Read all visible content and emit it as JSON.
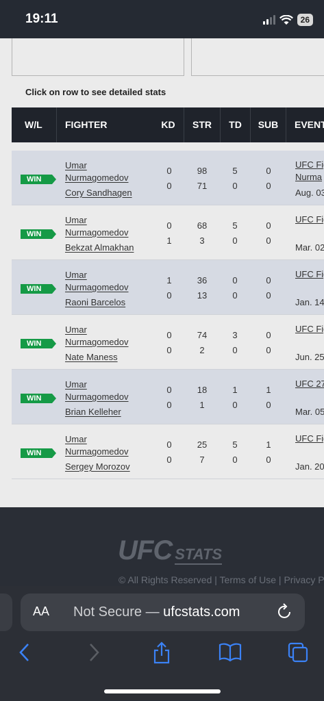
{
  "status": {
    "time": "19:11",
    "battery": "26"
  },
  "page": {
    "hint": "Click on row to see detailed stats"
  },
  "table": {
    "headers": [
      "W/L",
      "FIGHTER",
      "KD",
      "STR",
      "TD",
      "SUB",
      "EVENT"
    ],
    "rows": [
      {
        "result": "WIN",
        "f1a": "Umar",
        "f1b": "Nurmagomedov",
        "f2": "Cory Sandhagen",
        "kd": [
          "0",
          "0"
        ],
        "str": [
          "98",
          "71"
        ],
        "td": [
          "5",
          "0"
        ],
        "sub": [
          "0",
          "0"
        ],
        "event1": "UFC Fig",
        "event2": "Nurma",
        "date": "Aug. 03"
      },
      {
        "result": "WIN",
        "f1a": "Umar",
        "f1b": "Nurmagomedov",
        "f2": "Bekzat Almakhan",
        "kd": [
          "0",
          "1"
        ],
        "str": [
          "68",
          "3"
        ],
        "td": [
          "5",
          "0"
        ],
        "sub": [
          "0",
          "0"
        ],
        "event1": "UFC Fig",
        "event2": "",
        "date": "Mar. 02"
      },
      {
        "result": "WIN",
        "f1a": "Umar",
        "f1b": "Nurmagomedov",
        "f2": "Raoni Barcelos",
        "kd": [
          "1",
          "0"
        ],
        "str": [
          "36",
          "13"
        ],
        "td": [
          "0",
          "0"
        ],
        "sub": [
          "0",
          "0"
        ],
        "event1": "UFC Fig",
        "event2": "",
        "date": "Jan. 14"
      },
      {
        "result": "WIN",
        "f1a": "Umar",
        "f1b": "Nurmagomedov",
        "f2": "Nate Maness",
        "kd": [
          "0",
          "0"
        ],
        "str": [
          "74",
          "2"
        ],
        "td": [
          "3",
          "0"
        ],
        "sub": [
          "0",
          "0"
        ],
        "event1": "UFC Fig",
        "event2": "",
        "date": "Jun. 25"
      },
      {
        "result": "WIN",
        "f1a": "Umar",
        "f1b": "Nurmagomedov",
        "f2": "Brian Kelleher",
        "kd": [
          "0",
          "0"
        ],
        "str": [
          "18",
          "1"
        ],
        "td": [
          "1",
          "0"
        ],
        "sub": [
          "1",
          "0"
        ],
        "event1": "UFC 27",
        "event2": "",
        "date": "Mar. 05"
      },
      {
        "result": "WIN",
        "f1a": "Umar",
        "f1b": "Nurmagomedov",
        "f2": "Sergey Morozov",
        "kd": [
          "0",
          "0"
        ],
        "str": [
          "25",
          "7"
        ],
        "td": [
          "5",
          "0"
        ],
        "sub": [
          "1",
          "0"
        ],
        "event1": "UFC Fig",
        "event2": "",
        "date": "Jan. 20"
      }
    ]
  },
  "footer": {
    "logo_main": "UFC",
    "logo_sub": "STATS",
    "copyright": "© All Rights Reserved",
    "terms": "Terms of Use",
    "privacy": "Privacy Po"
  },
  "browser": {
    "aa": "AA",
    "url_prefix": "Not Secure — ",
    "url_host": "ufcstats.com"
  },
  "colors": {
    "win": "#159a46",
    "header": "#1f232b",
    "row_alt": "#d6dae3",
    "link_blue": "#3b82f6"
  }
}
